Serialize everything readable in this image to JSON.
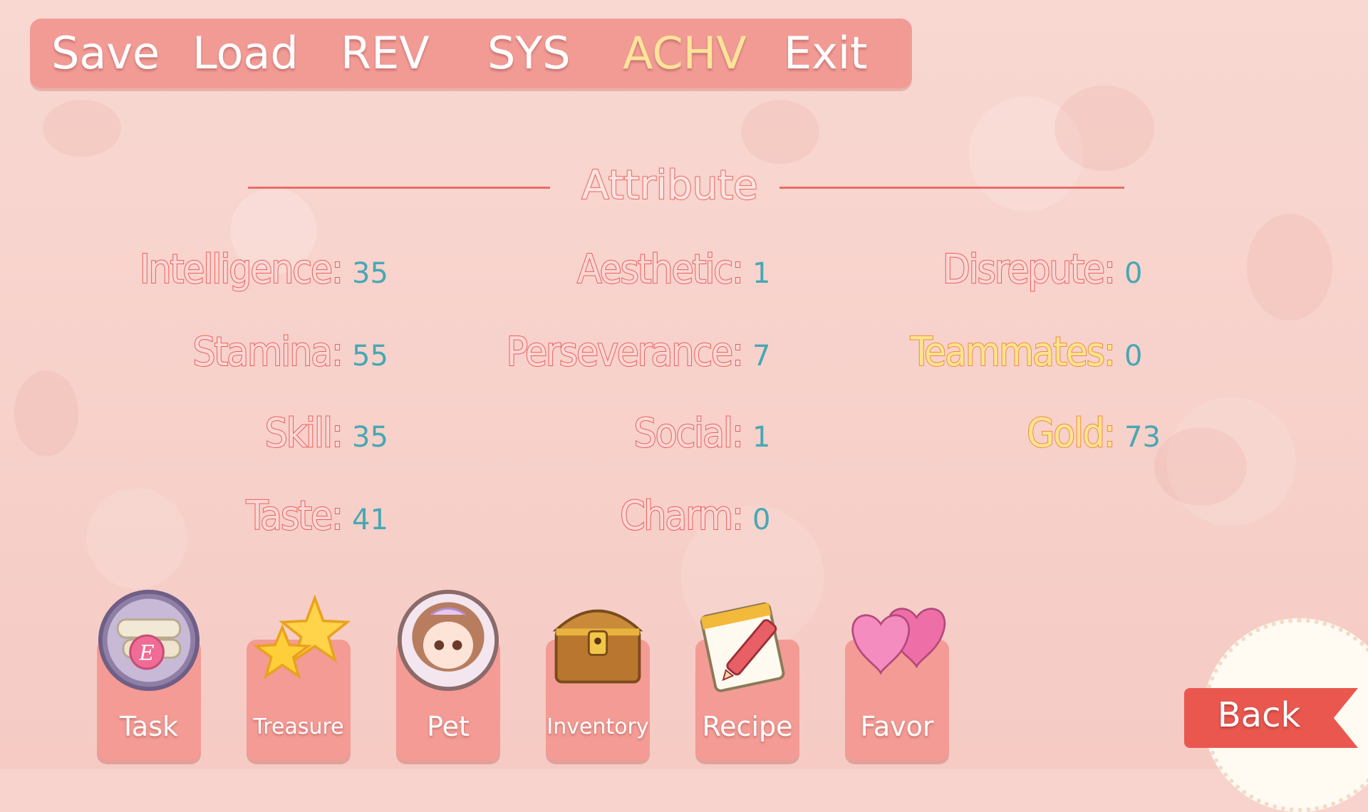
{
  "menu": {
    "items": [
      "Save",
      "Load",
      "REV",
      "SYS",
      "ACHV",
      "Exit"
    ],
    "active": "ACHV"
  },
  "title": "Attribute",
  "attributes": {
    "col1": [
      {
        "label": "Intelligence:",
        "value": "35"
      },
      {
        "label": "Stamina:",
        "value": "55"
      },
      {
        "label": "Skill:",
        "value": "35"
      },
      {
        "label": "Taste:",
        "value": "41"
      }
    ],
    "col2": [
      {
        "label": "Aesthetic:",
        "value": "1"
      },
      {
        "label": "Perseverance:",
        "value": "7"
      },
      {
        "label": "Social:",
        "value": "1"
      },
      {
        "label": "Charm:",
        "value": "0"
      }
    ],
    "col3": [
      {
        "label": "Disrepute:",
        "value": "0"
      },
      {
        "label": "Teammates:",
        "value": "0"
      },
      {
        "label": "Gold:",
        "value": "73"
      }
    ]
  },
  "buttons": [
    {
      "label": "Task",
      "icon": "scroll-seal-icon"
    },
    {
      "label": "Treasure",
      "icon": "stars-icon"
    },
    {
      "label": "Pet",
      "icon": "chibi-girl-avatar-icon"
    },
    {
      "label": "Inventory",
      "icon": "treasure-chest-icon"
    },
    {
      "label": "Recipe",
      "icon": "notepad-pencil-icon"
    },
    {
      "label": "Favor",
      "icon": "hearts-icon"
    }
  ],
  "back_label": "Back",
  "colors": {
    "menu_bg": "#f29b95",
    "active_menu": "#fde49a",
    "label_stroke": "#ea5f5c",
    "value_text": "#47a8b3",
    "gold_label": "#fde48c"
  }
}
